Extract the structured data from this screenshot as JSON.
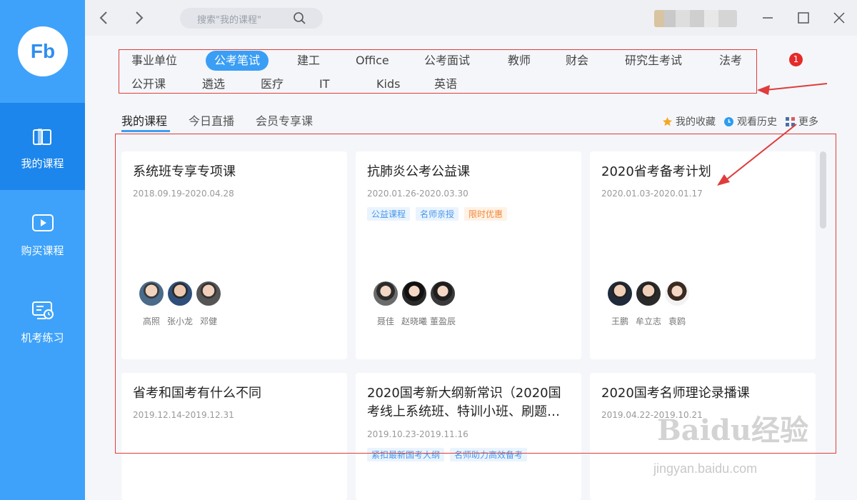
{
  "sidebar": {
    "logo_text": "Fb",
    "items": [
      {
        "label": "我的课程"
      },
      {
        "label": "购买课程"
      },
      {
        "label": "机考练习"
      }
    ]
  },
  "titlebar": {
    "search_placeholder": "搜索\"我的课程\""
  },
  "categories": {
    "row1": [
      "事业单位",
      "公考笔试",
      "建工",
      "Office",
      "公考面试",
      "教师",
      "财会",
      "研究生考试",
      "法考"
    ],
    "row2": [
      "公开课",
      "遴选",
      "医疗",
      "IT",
      "Kids",
      "英语"
    ],
    "selected": "公考笔试"
  },
  "notification_count": "1",
  "tabs": [
    "我的课程",
    "今日直播",
    "会员专享课"
  ],
  "tools": {
    "favorites": "我的收藏",
    "history": "观看历史",
    "more": "更多"
  },
  "colors": {
    "accent": "#3b9ef5",
    "sidebar": "#3ea2fa",
    "annotation": "#e03c3c"
  },
  "cards": [
    {
      "title": "系统班专享专项课",
      "dates": "2018.09.19-2020.04.28",
      "tags": [],
      "teachers": [
        "高照",
        "张小龙",
        "邓健"
      ]
    },
    {
      "title": "抗肺炎公考公益课",
      "dates": "2020.01.26-2020.03.30",
      "tags": [
        "公益课程",
        "名师亲授",
        "限时优惠"
      ],
      "teachers": [
        "聂佳",
        "赵晓曦",
        "董盈辰"
      ]
    },
    {
      "title": "2020省考备考计划",
      "dates": "2020.01.03-2020.01.17",
      "tags": [],
      "teachers": [
        "王鹏",
        "牟立志",
        "袁鸥"
      ]
    },
    {
      "title": "省考和国考有什么不同",
      "dates": "2019.12.14-2019.12.31",
      "tags": [],
      "teachers": []
    },
    {
      "title": "2020国考新大纲新常识（2020国考线上系统班、特训小班、刷题…",
      "dates": "2019.10.23-2019.11.16",
      "tags": [
        "紧扣最新国考大纲",
        "名师助力高效备考"
      ],
      "teachers": []
    },
    {
      "title": "2020国考名师理论录播课",
      "dates": "2019.04.22-2019.10.21",
      "tags": [],
      "teachers": []
    }
  ],
  "watermark": {
    "brand": "Baidu经验",
    "url": "jingyan.baidu.com"
  }
}
